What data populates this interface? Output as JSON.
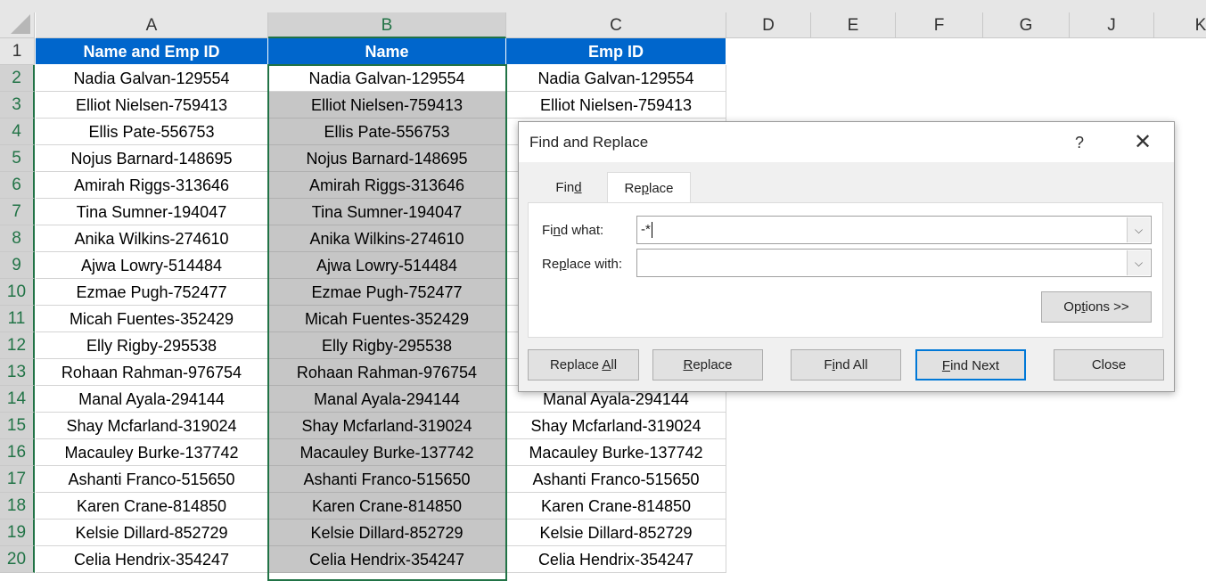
{
  "sheet": {
    "columns": [
      "A",
      "B",
      "C",
      "D",
      "E",
      "F",
      "G",
      "J",
      "K"
    ],
    "row_numbers": [
      "1",
      "2",
      "3",
      "4",
      "5",
      "6",
      "7",
      "8",
      "9",
      "10",
      "11",
      "12",
      "13",
      "14",
      "15",
      "16",
      "17",
      "18",
      "19",
      "20"
    ],
    "headers": [
      "Name and Emp ID",
      "Name",
      "Emp ID"
    ],
    "header_color": "#0066cc",
    "rows": [
      "Nadia Galvan-129554",
      "Elliot Nielsen-759413",
      "Ellis Pate-556753",
      "Nojus Barnard-148695",
      "Amirah Riggs-313646",
      "Tina Sumner-194047",
      "Anika Wilkins-274610",
      "Ajwa Lowry-514484",
      "Ezmae Pugh-752477",
      "Micah Fuentes-352429",
      "Elly Rigby-295538",
      "Rohaan Rahman-976754",
      "Manal Ayala-294144",
      "Shay Mcfarland-319024",
      "Macauley Burke-137742",
      "Ashanti Franco-515650",
      "Karen Crane-814850",
      "Kelsie Dillard-852729",
      "Celia Hendrix-354247"
    ]
  },
  "dialog": {
    "title": "Find and Replace",
    "help_label": "?",
    "close_icon": "close-icon",
    "tabs": [
      "Find",
      "Replace"
    ],
    "active_tab": "Replace",
    "find_what_label": "Find what:",
    "find_what_value": "-*",
    "replace_with_label": "Replace with:",
    "replace_with_value": "",
    "options_label": "Options >>",
    "buttons": {
      "replace_all": "Replace All",
      "replace": "Replace",
      "find_all": "Find All",
      "find_next": "Find Next",
      "close": "Close"
    }
  }
}
